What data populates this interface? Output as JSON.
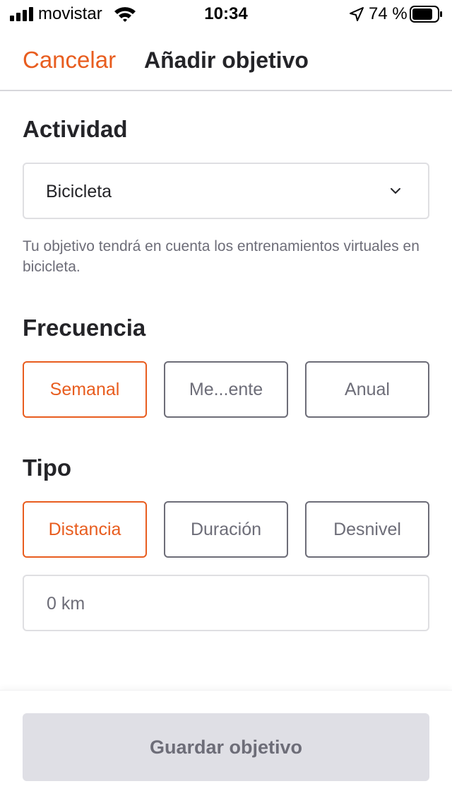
{
  "status_bar": {
    "carrier": "movistar",
    "time": "10:34",
    "battery": "74 %",
    "icons": [
      "signal-icon",
      "wifi-icon",
      "location-arrow-icon",
      "battery-icon"
    ]
  },
  "nav": {
    "cancel_label": "Cancelar",
    "title": "Añadir objetivo"
  },
  "activity": {
    "heading": "Actividad",
    "selected": "Bicicleta",
    "helper": "Tu objetivo tendrá en cuenta los entrenamientos virtuales en bicicleta."
  },
  "frequency": {
    "heading": "Frecuencia",
    "options": [
      {
        "label": "Semanal",
        "selected": true
      },
      {
        "label": "Me...ente",
        "selected": false
      },
      {
        "label": "Anual",
        "selected": false
      }
    ]
  },
  "type": {
    "heading": "Tipo",
    "options": [
      {
        "label": "Distancia",
        "selected": true
      },
      {
        "label": "Duración",
        "selected": false
      },
      {
        "label": "Desnivel",
        "selected": false
      }
    ]
  },
  "goal_input": {
    "value": "",
    "placeholder": "0 km"
  },
  "footer": {
    "save_label": "Guardar objetivo"
  },
  "colors": {
    "accent": "#e85d1f",
    "text": "#242428",
    "muted": "#6d6d78",
    "disabled_button": "#dfdfe5"
  }
}
